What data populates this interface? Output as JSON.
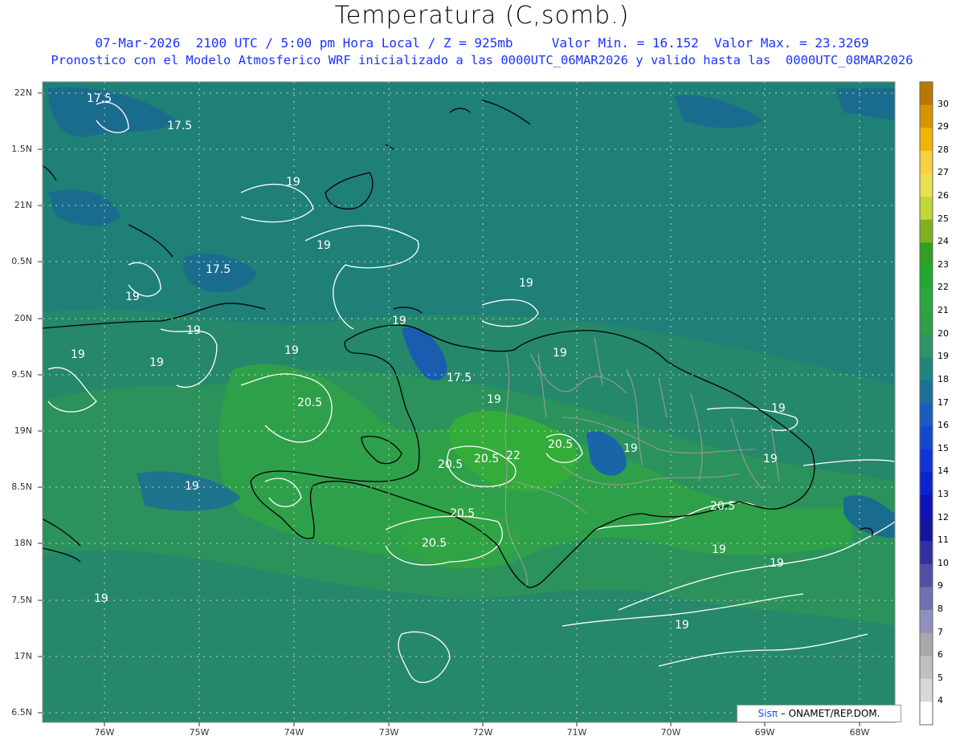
{
  "title": "Temperatura (C,somb.)",
  "subtitle_line1": "07-Mar-2026  2100 UTC / 5:00 pm Hora Local / Z = 925mb     Valor Min. = 16.152  Valor Max. = 23.3269",
  "subtitle_line2": "Pronostico con el Modelo Atmosferico WRF inicializado a las 0000UTC_06MAR2026 y valido hasta las  0000UTC_08MAR2026",
  "lat_labels": [
    "22N",
    "1.5N",
    "21N",
    "0.5N",
    "20N",
    "9.5N",
    "19N",
    "8.5N",
    "18N",
    "7.5N",
    "17N",
    "6.5N"
  ],
  "lon_labels": [
    "76W",
    "75W",
    "74W",
    "73W",
    "72W",
    "71W",
    "70W",
    "69W",
    "68W"
  ],
  "colorbar": {
    "labels": [
      "30",
      "29",
      "28",
      "27",
      "26",
      "25",
      "24",
      "23",
      "22",
      "21",
      "20",
      "19",
      "18",
      "17",
      "16",
      "15",
      "14",
      "13",
      "12",
      "11",
      "10",
      "9",
      "8",
      "7",
      "6",
      "5",
      "4"
    ],
    "colors": [
      "#b87800",
      "#d89400",
      "#f0b400",
      "#f8d040",
      "#e8e050",
      "#c0d838",
      "#80b020",
      "#30a020",
      "#20a830",
      "#28a840",
      "#30a048",
      "#2e9468",
      "#1e8480",
      "#1a7098",
      "#1a5cc0",
      "#1448d0",
      "#1034d8",
      "#0c22d0",
      "#0a14b8",
      "#1414a0",
      "#3030a0",
      "#5050a8",
      "#7070b0",
      "#9090c0",
      "#a8a8a8",
      "#c0c0c0",
      "#d8d8d8",
      "#ffffff"
    ]
  },
  "contour_labels": [
    "17.5",
    "17.5",
    "17.5",
    "17.5",
    "19",
    "19",
    "19",
    "19",
    "19",
    "19",
    "19",
    "19",
    "19",
    "19",
    "19",
    "19",
    "19",
    "19",
    "19",
    "19",
    "19",
    "19",
    "19",
    "20.5",
    "20.5",
    "20.5",
    "20.5",
    "20.5",
    "20.5",
    "20.5",
    "22"
  ],
  "credit": {
    "sis": "Sisπ",
    "org": " – ONAMET/REP.DOM."
  },
  "colors": {
    "ocean": "#1a7a7e",
    "land_warm": "#2ca043",
    "land_mid": "#2e9460",
    "contour": "#ffffff",
    "title": "#000000",
    "subtitle": "#1a33ff"
  }
}
